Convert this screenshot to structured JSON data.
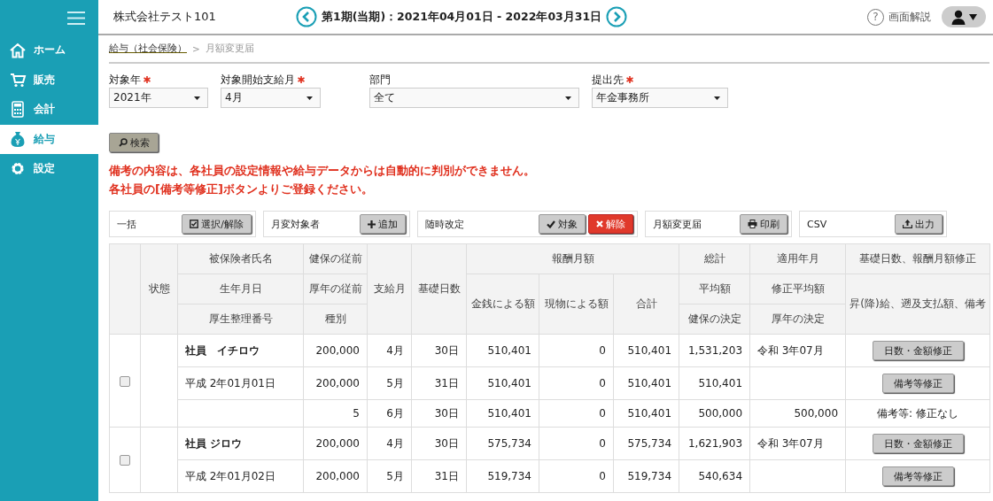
{
  "sidebar": {
    "items": [
      {
        "label": "ホーム",
        "kind": "home",
        "selected": false
      },
      {
        "label": "販売",
        "kind": "cart",
        "selected": false
      },
      {
        "label": "会計",
        "kind": "calculator",
        "selected": false
      },
      {
        "label": "給与",
        "kind": "moneybag",
        "selected": true
      },
      {
        "label": "設定",
        "kind": "gear",
        "selected": false
      }
    ]
  },
  "header": {
    "company": "株式会社テスト101",
    "period": "第1期(当期)：2021年04月01日 - 2022年03月31日",
    "help": "画面解説",
    "help_mark": "?"
  },
  "breadcrumb": {
    "link": "給与（社会保険）",
    "separator": ">",
    "current": "月額変更届"
  },
  "filters": [
    {
      "label": "対象年",
      "required": true,
      "value": "2021年"
    },
    {
      "label": "対象開始支給月",
      "required": true,
      "value": "4月"
    },
    {
      "label": "部門",
      "required": false,
      "value": "全て"
    },
    {
      "label": "提出先",
      "required": true,
      "value": "年金事務所"
    }
  ],
  "search_button": "検索",
  "notice": [
    "備考の内容は、各社員の設定情報や給与データからは自動的に判別ができません。",
    "各社員の[備考等修正]ボタンよりご登録ください。"
  ],
  "toolbar": [
    {
      "label": "一括",
      "buttons": [
        {
          "label": "選択/解除",
          "kind": "select"
        }
      ]
    },
    {
      "label": "月変対象者",
      "buttons": [
        {
          "label": "追加",
          "kind": "add"
        }
      ]
    },
    {
      "label": "随時改定",
      "buttons": [
        {
          "label": "対象",
          "kind": "target"
        },
        {
          "label": "解除",
          "kind": "cancel"
        }
      ]
    },
    {
      "label": "月額変更届",
      "buttons": [
        {
          "label": "印刷",
          "kind": "print"
        }
      ]
    },
    {
      "label": "CSV",
      "buttons": [
        {
          "label": "出力",
          "kind": "export"
        }
      ]
    }
  ],
  "table": {
    "header": {
      "status": "状態",
      "name": "被保険者氏名",
      "birth": "生年月日",
      "number": "厚生整理番号",
      "health_prev": "健保の従前",
      "pension_prev": "厚年の従前",
      "type": "種別",
      "month": "支給月",
      "days": "基礎日数",
      "pay": "報酬月額",
      "cash": "金銭による額",
      "kind": "現物による額",
      "total": "合計",
      "sum": "総計",
      "average": "平均額",
      "health_decision": "健保の決定",
      "applied": "適用年月",
      "corrected_average": "修正平均額",
      "pension_decision": "厚年の決定",
      "fix": "基礎日数、報酬月額修正",
      "remarks": "昇(降)給、遡及支払額、備考"
    },
    "rows": [
      {
        "checked": false,
        "lines": [
          {
            "col_a": "社員　イチロウ",
            "col_b": "200,000",
            "month": "4月",
            "days": "30日",
            "cash": "510,401",
            "kind": "0",
            "total": "510,401",
            "col_c": "1,531,203",
            "col_d": "令和 3年07月",
            "action": {
              "kind": "button",
              "label": "日数・金額修正"
            }
          },
          {
            "col_a": "平成 2年01月01日",
            "col_b": "200,000",
            "month": "5月",
            "days": "31日",
            "cash": "510,401",
            "kind": "0",
            "total": "510,401",
            "col_c": "510,401",
            "action": {
              "kind": "button",
              "label": "備考等修正"
            }
          },
          {
            "col_b": "5",
            "month": "6月",
            "days": "30日",
            "cash": "510,401",
            "kind": "0",
            "total": "510,401",
            "col_c": "500,000",
            "col_d": "500,000",
            "action": {
              "kind": "text",
              "label": "備考等: 修正なし"
            }
          }
        ]
      },
      {
        "checked": false,
        "lines": [
          {
            "col_a": "社員 ジロウ",
            "col_b": "200,000",
            "month": "4月",
            "days": "30日",
            "cash": "575,734",
            "kind": "0",
            "total": "575,734",
            "col_c": "1,621,903",
            "col_d": "令和 3年07月",
            "action": {
              "kind": "button",
              "label": "日数・金額修正"
            }
          },
          {
            "col_a": "平成 2年01月02日",
            "col_b": "200,000",
            "month": "5月",
            "days": "31日",
            "cash": "519,734",
            "kind": "0",
            "total": "519,734",
            "col_c": "540,634",
            "action": {
              "kind": "button",
              "label": "備考等修正"
            }
          }
        ]
      }
    ]
  }
}
